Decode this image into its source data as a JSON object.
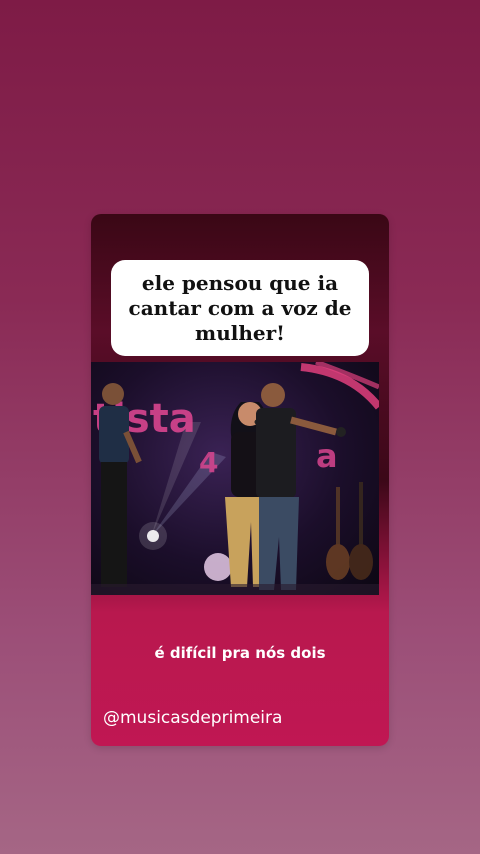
{
  "story": {
    "caption": "ele pensou que ia cantar com a voz de mulher!",
    "subtitle": "é difícil pra nós dois",
    "handle": "@musicasdeprimeira"
  },
  "video": {
    "stage_sign": "tista",
    "stage_sign_2": "4",
    "colors": {
      "sign_pink": "#d9458f",
      "performer_gold": "#c8a25c",
      "background_top": "#7e1b46",
      "background_bottom": "#a56685",
      "card_accent": "#c01753"
    }
  }
}
